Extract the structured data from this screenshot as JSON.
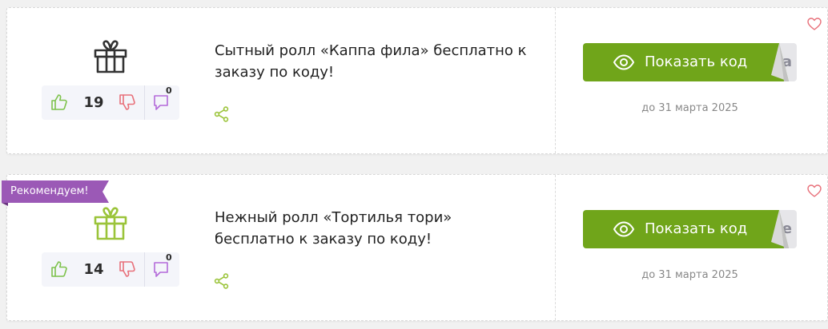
{
  "colors": {
    "accent_green": "#70a51a",
    "ribbon_purple": "#9b59b6",
    "like_green": "#7dc24b",
    "dislike_red": "#e8707a",
    "comment_purple": "#b36ad9",
    "heart_red": "#e8707a",
    "gift_dark": "#333333",
    "gift_green": "#9bc43a"
  },
  "coupons": [
    {
      "title": "Сытный ролл «Каппа фила» бесплатно к заказу по коду!",
      "likes": "19",
      "comments": "0",
      "button_label": "Показать код",
      "code_peek": "а",
      "expiry": "до 31 марта 2025",
      "icon": "gift-icon-dark"
    },
    {
      "badge": "Рекомендуем!",
      "title": "Нежный ролл «Тортилья тори» бесплатно к заказу по коду!",
      "likes": "14",
      "comments": "0",
      "button_label": "Показать код",
      "code_peek": "е",
      "expiry": "до 31 марта 2025",
      "icon": "gift-icon-green"
    }
  ]
}
